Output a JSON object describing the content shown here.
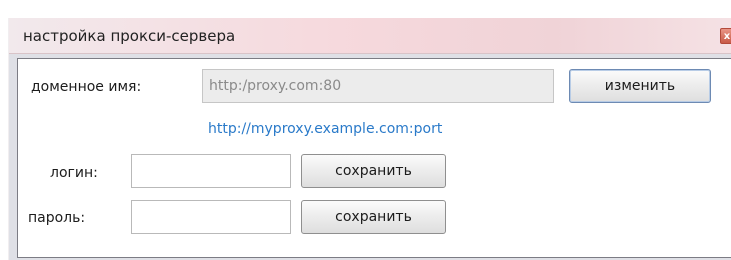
{
  "window": {
    "title": "настройка прокси-сервера",
    "close_glyph": "x"
  },
  "proxy": {
    "domain_label": "доменное имя:",
    "domain_value": "",
    "domain_placeholder": "http:/proxy.com:80",
    "change_button": "изменить",
    "example_link": "http://myproxy.example.com:port"
  },
  "login": {
    "label": "логин:",
    "value": "",
    "save_button": "сохранить"
  },
  "password": {
    "label": "пароль:",
    "value": "",
    "save_button": "сохранить"
  },
  "icons": {
    "close": "close-icon"
  }
}
